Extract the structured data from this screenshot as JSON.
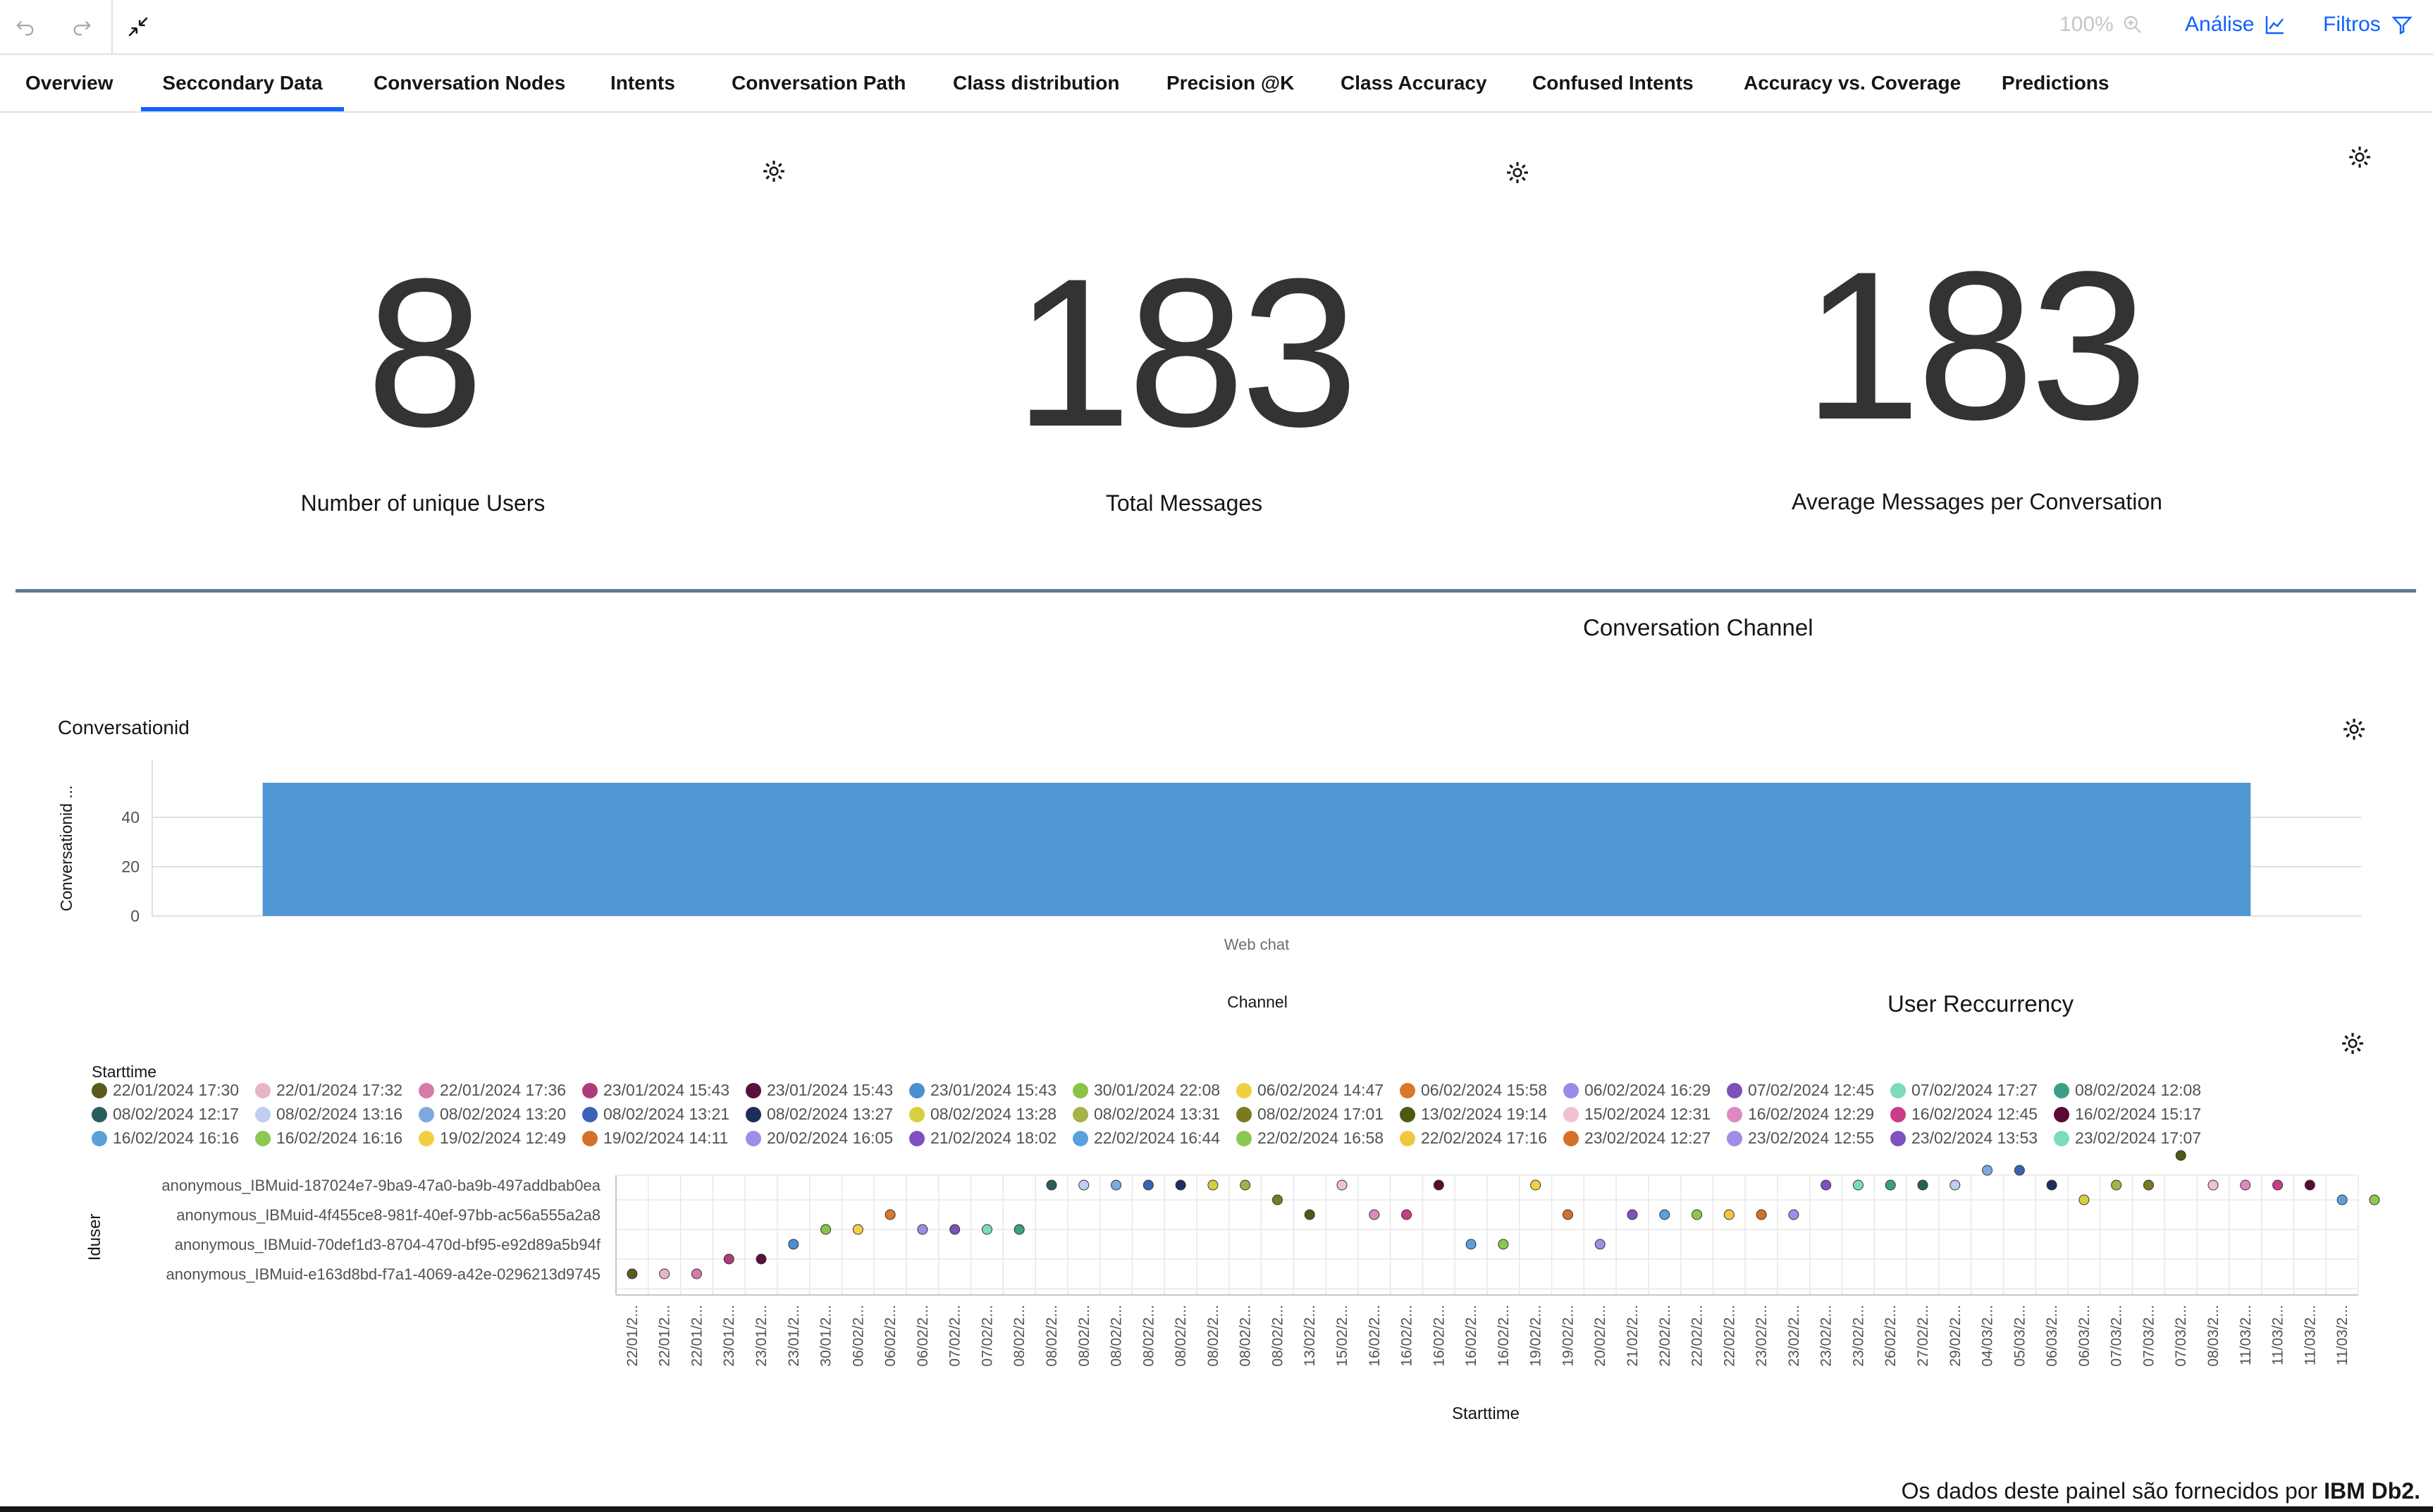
{
  "toolbar": {
    "zoom": "100%",
    "analise": "Análise",
    "filtros": "Filtros"
  },
  "tabs": [
    {
      "label": "Overview"
    },
    {
      "label": "Seccondary Data"
    },
    {
      "label": "Conversation Nodes"
    },
    {
      "label": "Intents"
    },
    {
      "label": "Conversation Path"
    },
    {
      "label": "Class distribution"
    },
    {
      "label": "Precision @K"
    },
    {
      "label": "Class Accuracy"
    },
    {
      "label": "Confused Intents"
    },
    {
      "label": "Accuracy vs. Coverage"
    },
    {
      "label": "Predictions"
    }
  ],
  "kpis": [
    {
      "value": "8",
      "label": "Number of unique Users"
    },
    {
      "value": "183",
      "label": "Total Messages"
    },
    {
      "value": "183",
      "label": "Average Messages per Conversation"
    }
  ],
  "sections": {
    "channel_title": "Conversation Channel",
    "recurrency_title": "User Reccurrency"
  },
  "footer": {
    "text": "Os dados deste painel são fornecidos por ",
    "brand": "IBM Db2."
  },
  "chart_data": [
    {
      "type": "bar",
      "title": "Conversationid",
      "xlabel": "Channel",
      "ylabel": "Conversationid ...",
      "categories": [
        "Web chat"
      ],
      "values": [
        54
      ],
      "ylim": [
        0,
        60
      ],
      "yticks": [
        0,
        20,
        40
      ],
      "color": "#5098d4",
      "grid": true
    },
    {
      "type": "scatter",
      "xlabel": "Starttime",
      "ylabel": "Iduser",
      "legend_title": "Starttime",
      "users": [
        "anonymous_IBMuid-187024e7-9ba9-47a0-ba9b-497addbab0ea",
        "anonymous_IBMuid-4f455ce8-981f-40ef-97bb-ac56a555a2a8",
        "anonymous_IBMuid-70def1d3-8704-470d-bf95-e92d89a5b94f",
        "anonymous_IBMuid-e163d8bd-f7a1-4069-a42e-0296213d9745"
      ],
      "legend": [
        {
          "label": "22/01/2024 17:30",
          "color": "#5a5a1e"
        },
        {
          "label": "22/01/2024 17:32",
          "color": "#e8b4c8"
        },
        {
          "label": "22/01/2024 17:36",
          "color": "#d47ba8"
        },
        {
          "label": "23/01/2024 15:43",
          "color": "#b03a7c"
        },
        {
          "label": "23/01/2024 15:43",
          "color": "#5c0f3c"
        },
        {
          "label": "23/01/2024 15:43",
          "color": "#4a8fd0"
        },
        {
          "label": "30/01/2024 22:08",
          "color": "#8bc34a"
        },
        {
          "label": "06/02/2024 14:47",
          "color": "#f0d040"
        },
        {
          "label": "06/02/2024 15:58",
          "color": "#d9782a"
        },
        {
          "label": "06/02/2024 16:29",
          "color": "#9b8be8"
        },
        {
          "label": "07/02/2024 12:45",
          "color": "#7d4fb8"
        },
        {
          "label": "07/02/2024 17:27",
          "color": "#7edbb8"
        },
        {
          "label": "08/02/2024 12:08",
          "color": "#3d9e88"
        },
        {
          "label": "08/02/2024 12:17",
          "color": "#2a5e5a"
        },
        {
          "label": "08/02/2024 13:16",
          "color": "#c0ccf0"
        },
        {
          "label": "08/02/2024 13:20",
          "color": "#7ea8e0"
        },
        {
          "label": "08/02/2024 13:21",
          "color": "#3a62b8"
        },
        {
          "label": "08/02/2024 13:27",
          "color": "#1e2e5a"
        },
        {
          "label": "08/02/2024 13:28",
          "color": "#d4d040"
        },
        {
          "label": "08/02/2024 13:31",
          "color": "#a8b048"
        },
        {
          "label": "08/02/2024 17:01",
          "color": "#7a7a20"
        },
        {
          "label": "13/02/2024 19:14",
          "color": "#4e5a14"
        },
        {
          "label": "15/02/2024 12:31",
          "color": "#f0c0d4"
        },
        {
          "label": "16/02/2024 12:29",
          "color": "#e088c0"
        },
        {
          "label": "16/02/2024 12:45",
          "color": "#c83c88"
        },
        {
          "label": "16/02/2024 15:17",
          "color": "#5a0a34"
        },
        {
          "label": "16/02/2024 16:16",
          "color": "#5aa0dc"
        },
        {
          "label": "16/02/2024 16:16",
          "color": "#8cc850"
        },
        {
          "label": "19/02/2024 12:49",
          "color": "#f0d040"
        },
        {
          "label": "19/02/2024 14:11",
          "color": "#d47028"
        },
        {
          "label": "20/02/2024 16:05",
          "color": "#a08ce8"
        },
        {
          "label": "21/02/2024 18:02",
          "color": "#8050c0"
        },
        {
          "label": "22/02/2024 16:44",
          "color": "#5aa0dc"
        },
        {
          "label": "22/02/2024 16:58",
          "color": "#8cc850"
        },
        {
          "label": "22/02/2024 17:16",
          "color": "#f0c840"
        },
        {
          "label": "23/02/2024 12:27",
          "color": "#d47028"
        },
        {
          "label": "23/02/2024 12:55",
          "color": "#a08ce8"
        },
        {
          "label": "23/02/2024 13:53",
          "color": "#8050c0"
        },
        {
          "label": "23/02/2024 17:07",
          "color": "#7edbb8"
        }
      ],
      "x_ticks": [
        "22/01/2...",
        "22/01/2...",
        "22/01/2...",
        "23/01/2...",
        "23/01/2...",
        "23/01/2...",
        "30/01/2...",
        "06/02/2...",
        "06/02/2...",
        "06/02/2...",
        "07/02/2...",
        "07/02/2...",
        "08/02/2...",
        "08/02/2...",
        "08/02/2...",
        "08/02/2...",
        "08/02/2...",
        "08/02/2...",
        "08/02/2...",
        "08/02/2...",
        "08/02/2...",
        "13/02/2...",
        "15/02/2...",
        "16/02/2...",
        "16/02/2...",
        "16/02/2...",
        "16/02/2...",
        "16/02/2...",
        "19/02/2...",
        "19/02/2...",
        "20/02/2...",
        "21/02/2...",
        "22/02/2...",
        "22/02/2...",
        "22/02/2...",
        "23/02/2...",
        "23/02/2...",
        "23/02/2...",
        "23/02/2...",
        "26/02/2...",
        "27/02/2...",
        "29/02/2...",
        "04/03/2...",
        "05/03/2...",
        "06/03/2...",
        "06/03/2...",
        "07/03/2...",
        "07/03/2...",
        "07/03/2...",
        "08/03/2...",
        "11/03/2...",
        "11/03/2...",
        "11/03/2...",
        "11/03/2..."
      ],
      "points": [
        {
          "x": 0,
          "y": 3,
          "color": "#5a5a1e"
        },
        {
          "x": 1,
          "y": 3,
          "color": "#e8b4c8"
        },
        {
          "x": 2,
          "y": 3,
          "color": "#d47ba8"
        },
        {
          "x": 3,
          "y": 2.5,
          "color": "#b03a7c"
        },
        {
          "x": 4,
          "y": 2.5,
          "color": "#5c0f3c"
        },
        {
          "x": 5,
          "y": 2,
          "color": "#4a8fd0"
        },
        {
          "x": 6,
          "y": 1.5,
          "color": "#8bc34a"
        },
        {
          "x": 7,
          "y": 1.5,
          "color": "#f0d040"
        },
        {
          "x": 8,
          "y": 1,
          "color": "#d9782a"
        },
        {
          "x": 9,
          "y": 1.5,
          "color": "#9b8be8"
        },
        {
          "x": 10,
          "y": 1.5,
          "color": "#7d4fb8"
        },
        {
          "x": 11,
          "y": 1.5,
          "color": "#7edbb8"
        },
        {
          "x": 12,
          "y": 1.5,
          "color": "#3d9e88"
        },
        {
          "x": 13,
          "y": 0,
          "color": "#2a5e5a"
        },
        {
          "x": 14,
          "y": 0,
          "color": "#c0ccf0"
        },
        {
          "x": 15,
          "y": 0,
          "color": "#7ea8e0"
        },
        {
          "x": 16,
          "y": 0,
          "color": "#3a62b8"
        },
        {
          "x": 17,
          "y": 0,
          "color": "#1e2e5a"
        },
        {
          "x": 18,
          "y": 0,
          "color": "#d4d040"
        },
        {
          "x": 19,
          "y": 0,
          "color": "#a8b048"
        },
        {
          "x": 20,
          "y": 0.5,
          "color": "#7a7a20"
        },
        {
          "x": 21,
          "y": 1,
          "color": "#4e5a14"
        },
        {
          "x": 22,
          "y": 0,
          "color": "#f0c0d4"
        },
        {
          "x": 23,
          "y": 1,
          "color": "#e088c0"
        },
        {
          "x": 24,
          "y": 1,
          "color": "#c83c88"
        },
        {
          "x": 25,
          "y": 0,
          "color": "#5a0a34"
        },
        {
          "x": 26,
          "y": 2,
          "color": "#5aa0dc"
        },
        {
          "x": 27,
          "y": 2,
          "color": "#8cc850"
        },
        {
          "x": 28,
          "y": 0,
          "color": "#f0d040"
        },
        {
          "x": 29,
          "y": 1,
          "color": "#d47028"
        },
        {
          "x": 30,
          "y": 2,
          "color": "#a08ce8"
        },
        {
          "x": 31,
          "y": 1,
          "color": "#8050c0"
        },
        {
          "x": 32,
          "y": 1,
          "color": "#5aa0dc"
        },
        {
          "x": 33,
          "y": 1,
          "color": "#8cc850"
        },
        {
          "x": 34,
          "y": 1,
          "color": "#f0c840"
        },
        {
          "x": 35,
          "y": 1,
          "color": "#d47028"
        },
        {
          "x": 36,
          "y": 1,
          "color": "#a08ce8"
        },
        {
          "x": 37,
          "y": 0,
          "color": "#8050c0"
        },
        {
          "x": 38,
          "y": 0,
          "color": "#7edbb8"
        },
        {
          "x": 39,
          "y": 0,
          "color": "#3d9e88"
        },
        {
          "x": 40,
          "y": 0,
          "color": "#2a5e5a"
        },
        {
          "x": 41,
          "y": 0,
          "color": "#c0ccf0"
        },
        {
          "x": 42,
          "y": -0.5,
          "color": "#7ea8e0"
        },
        {
          "x": 43,
          "y": -0.5,
          "color": "#3a62b8"
        },
        {
          "x": 44,
          "y": 0,
          "color": "#1e2e5a"
        },
        {
          "x": 45,
          "y": 0.5,
          "color": "#d4d040"
        },
        {
          "x": 46,
          "y": 0,
          "color": "#a8b048"
        },
        {
          "x": 47,
          "y": 0,
          "color": "#7a7a20"
        },
        {
          "x": 48,
          "y": -1,
          "color": "#4e5a14"
        },
        {
          "x": 49,
          "y": 0,
          "color": "#f0c0d4"
        },
        {
          "x": 50,
          "y": 0,
          "color": "#e088c0"
        },
        {
          "x": 51,
          "y": 0,
          "color": "#c83c88"
        },
        {
          "x": 52,
          "y": 0,
          "color": "#5a0a34"
        },
        {
          "x": 53,
          "y": 0.5,
          "color": "#5aa0dc"
        },
        {
          "x": 54,
          "y": 0.5,
          "color": "#8cc850"
        }
      ]
    }
  ]
}
